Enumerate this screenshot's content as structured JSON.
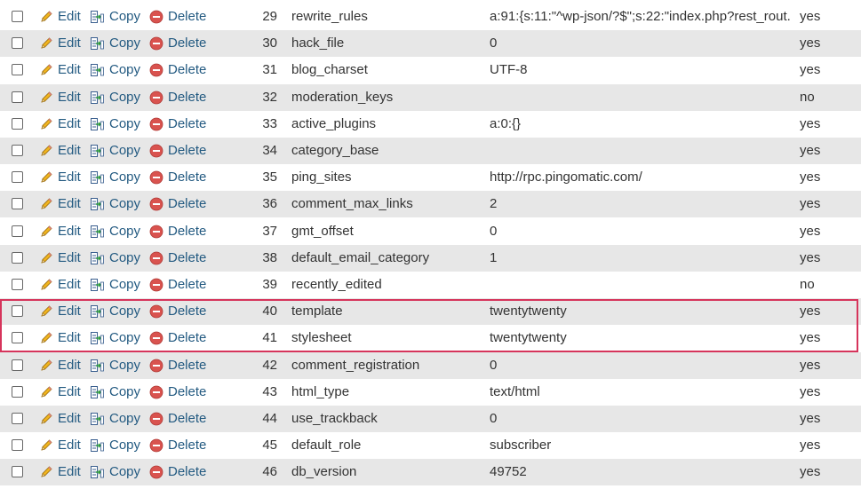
{
  "actions": {
    "edit_label": "Edit",
    "copy_label": "Copy",
    "delete_label": "Delete",
    "edit_icon": "pencil-icon",
    "copy_icon": "copy-icon",
    "delete_icon": "delete-circle-icon"
  },
  "colors": {
    "link": "#235a81",
    "row_alt": "#e7e7e7",
    "highlight_border": "#d6345b",
    "delete_red": "#d9534f"
  },
  "rows": [
    {
      "id": "29",
      "name": "rewrite_rules",
      "value": "a:91:{s:11:\"^wp-json/?$\";s:22:\"index.php?rest_rout...",
      "autoload": "yes"
    },
    {
      "id": "30",
      "name": "hack_file",
      "value": "0",
      "autoload": "yes"
    },
    {
      "id": "31",
      "name": "blog_charset",
      "value": "UTF-8",
      "autoload": "yes"
    },
    {
      "id": "32",
      "name": "moderation_keys",
      "value": "",
      "autoload": "no"
    },
    {
      "id": "33",
      "name": "active_plugins",
      "value": "a:0:{}",
      "autoload": "yes"
    },
    {
      "id": "34",
      "name": "category_base",
      "value": "",
      "autoload": "yes"
    },
    {
      "id": "35",
      "name": "ping_sites",
      "value": "http://rpc.pingomatic.com/",
      "autoload": "yes"
    },
    {
      "id": "36",
      "name": "comment_max_links",
      "value": "2",
      "autoload": "yes"
    },
    {
      "id": "37",
      "name": "gmt_offset",
      "value": "0",
      "autoload": "yes"
    },
    {
      "id": "38",
      "name": "default_email_category",
      "value": "1",
      "autoload": "yes"
    },
    {
      "id": "39",
      "name": "recently_edited",
      "value": "",
      "autoload": "no"
    },
    {
      "id": "40",
      "name": "template",
      "value": "twentytwenty",
      "autoload": "yes",
      "highlighted": true
    },
    {
      "id": "41",
      "name": "stylesheet",
      "value": "twentytwenty",
      "autoload": "yes",
      "highlighted": true
    },
    {
      "id": "42",
      "name": "comment_registration",
      "value": "0",
      "autoload": "yes"
    },
    {
      "id": "43",
      "name": "html_type",
      "value": "text/html",
      "autoload": "yes"
    },
    {
      "id": "44",
      "name": "use_trackback",
      "value": "0",
      "autoload": "yes"
    },
    {
      "id": "45",
      "name": "default_role",
      "value": "subscriber",
      "autoload": "yes"
    },
    {
      "id": "46",
      "name": "db_version",
      "value": "49752",
      "autoload": "yes"
    }
  ]
}
